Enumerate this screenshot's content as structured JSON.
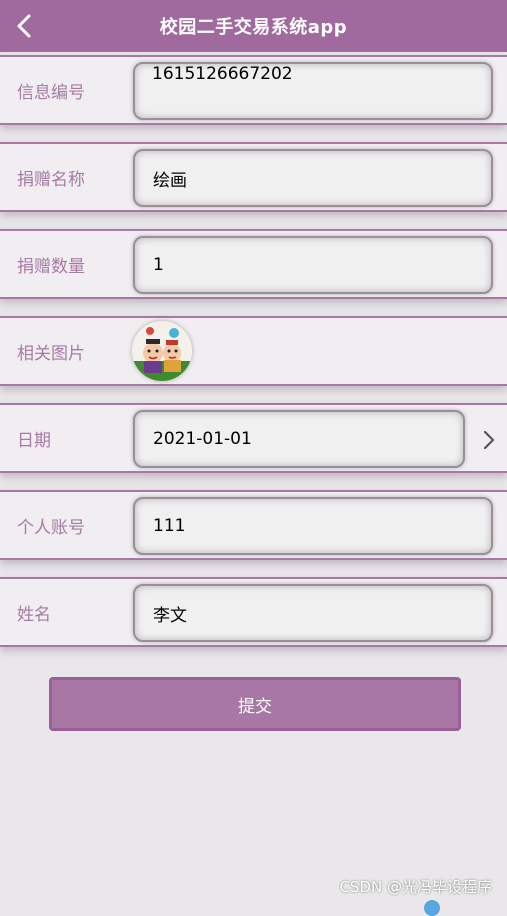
{
  "header": {
    "title": "校园二手交易系统app",
    "back_icon": "chevron-left-icon"
  },
  "form": {
    "fields": [
      {
        "label": "信息编号",
        "value": "1615126667202"
      },
      {
        "label": "捐赠名称",
        "value": "绘画"
      },
      {
        "label": "捐赠数量",
        "value": "1"
      },
      {
        "label": "相关图片",
        "value": ""
      },
      {
        "label": "日期",
        "value": "2021-01-01"
      },
      {
        "label": "个人账号",
        "value": "111"
      },
      {
        "label": "姓名",
        "value": "李文"
      }
    ],
    "submit_label": "提交",
    "date_arrow_icon": "chevron-right-icon"
  },
  "watermark": "CSDN @光冯毕设程序",
  "colors": {
    "header": "#a06a9e",
    "accent": "#a877a6",
    "label": "#a77aa5",
    "background": "#e9e7e9"
  }
}
